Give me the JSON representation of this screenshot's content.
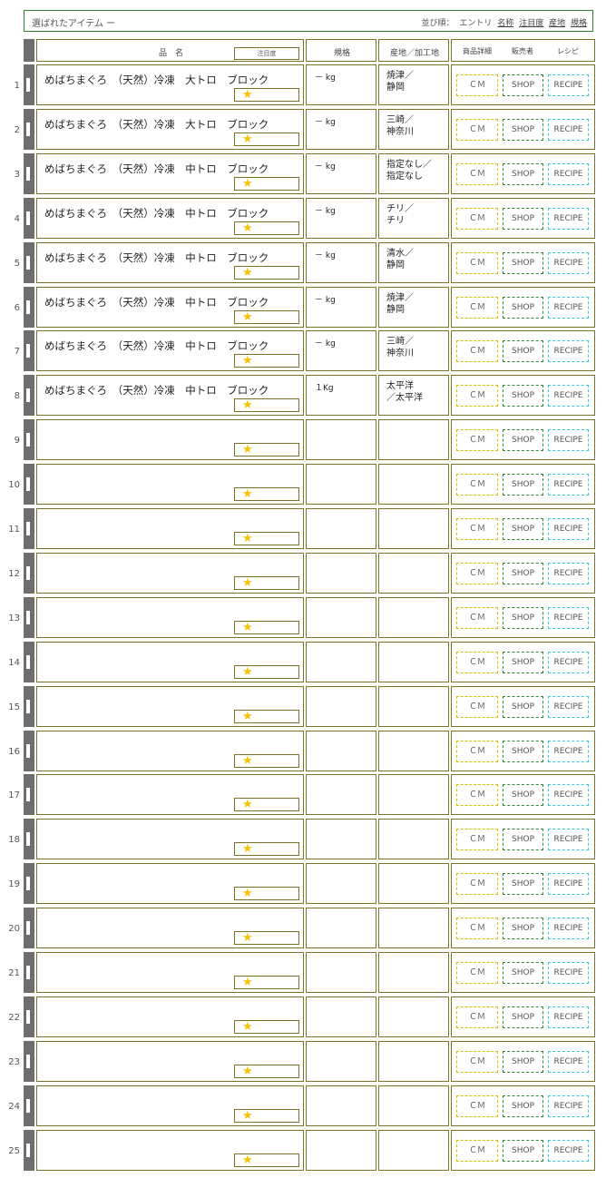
{
  "header": {
    "title": "選ばれたアイテム ー",
    "sort_label": "並び順：",
    "sort_options": [
      "エントリ",
      "名称",
      "注目度",
      "産地",
      "規格"
    ]
  },
  "columns": {
    "name": "品　名",
    "attention": "注目度",
    "spec": "規格",
    "origin": "産地／加工地",
    "detail": "商品詳細",
    "seller": "販売者",
    "recipe": "レシピ"
  },
  "buttons": {
    "cm": "ＣＭ",
    "shop": "SHOP",
    "recipe": "RECIPE"
  },
  "star_symbol": "★",
  "rows": [
    {
      "num": "1",
      "name": "めばちまぐろ　（天然）冷凍　大トロ　ブロック",
      "spec": "－ kg",
      "origin1": "焼津／",
      "origin2": "静岡"
    },
    {
      "num": "2",
      "name": "めばちまぐろ　（天然）冷凍　大トロ　ブロック",
      "spec": "－ kg",
      "origin1": "三崎／",
      "origin2": "神奈川"
    },
    {
      "num": "3",
      "name": "めばちまぐろ　（天然）冷凍　中トロ　ブロック",
      "spec": "－ kg",
      "origin1": "指定なし／",
      "origin2": "指定なし"
    },
    {
      "num": "4",
      "name": "めばちまぐろ　（天然）冷凍　中トロ　ブロック",
      "spec": "－ kg",
      "origin1": "チリ／",
      "origin2": "チリ"
    },
    {
      "num": "5",
      "name": "めばちまぐろ　（天然）冷凍　中トロ　ブロック",
      "spec": "－ kg",
      "origin1": "清水／",
      "origin2": "静岡"
    },
    {
      "num": "6",
      "name": "めばちまぐろ　（天然）冷凍　中トロ　ブロック",
      "spec": "－ kg",
      "origin1": "焼津／",
      "origin2": "静岡"
    },
    {
      "num": "7",
      "name": "めばちまぐろ　（天然）冷凍　中トロ　ブロック",
      "spec": "－ kg",
      "origin1": "三崎／",
      "origin2": "神奈川"
    },
    {
      "num": "8",
      "name": "めばちまぐろ　（天然）冷凍　中トロ　ブロック",
      "spec": "１Kg",
      "origin1": "太平洋",
      "origin2": "／太平洋"
    },
    {
      "num": "9",
      "name": "",
      "spec": "",
      "origin1": "",
      "origin2": ""
    },
    {
      "num": "10",
      "name": "",
      "spec": "",
      "origin1": "",
      "origin2": ""
    },
    {
      "num": "11",
      "name": "",
      "spec": "",
      "origin1": "",
      "origin2": ""
    },
    {
      "num": "12",
      "name": "",
      "spec": "",
      "origin1": "",
      "origin2": ""
    },
    {
      "num": "13",
      "name": "",
      "spec": "",
      "origin1": "",
      "origin2": ""
    },
    {
      "num": "14",
      "name": "",
      "spec": "",
      "origin1": "",
      "origin2": ""
    },
    {
      "num": "15",
      "name": "",
      "spec": "",
      "origin1": "",
      "origin2": ""
    },
    {
      "num": "16",
      "name": "",
      "spec": "",
      "origin1": "",
      "origin2": ""
    },
    {
      "num": "17",
      "name": "",
      "spec": "",
      "origin1": "",
      "origin2": ""
    },
    {
      "num": "18",
      "name": "",
      "spec": "",
      "origin1": "",
      "origin2": ""
    },
    {
      "num": "19",
      "name": "",
      "spec": "",
      "origin1": "",
      "origin2": ""
    },
    {
      "num": "20",
      "name": "",
      "spec": "",
      "origin1": "",
      "origin2": ""
    },
    {
      "num": "21",
      "name": "",
      "spec": "",
      "origin1": "",
      "origin2": ""
    },
    {
      "num": "22",
      "name": "",
      "spec": "",
      "origin1": "",
      "origin2": ""
    },
    {
      "num": "23",
      "name": "",
      "spec": "",
      "origin1": "",
      "origin2": ""
    },
    {
      "num": "24",
      "name": "",
      "spec": "",
      "origin1": "",
      "origin2": ""
    },
    {
      "num": "25",
      "name": "",
      "spec": "",
      "origin1": "",
      "origin2": ""
    }
  ]
}
